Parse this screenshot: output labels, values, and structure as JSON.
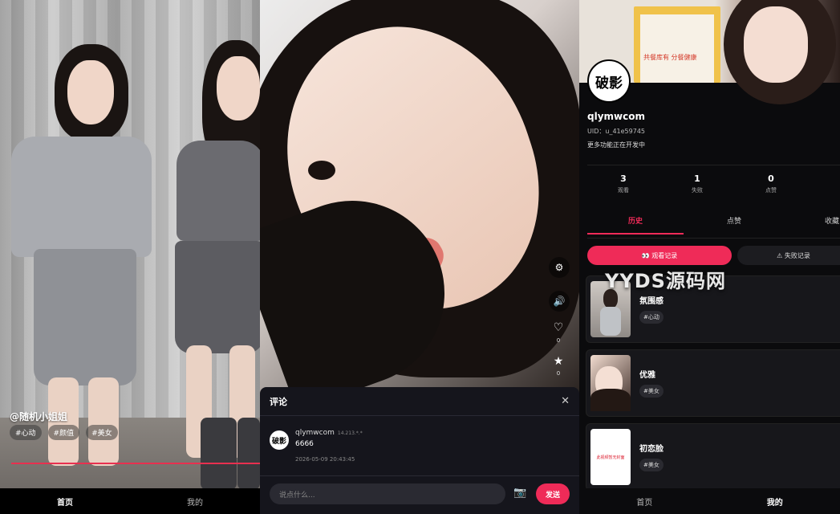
{
  "feed": {
    "username": "@随机小姐姐",
    "tags": [
      "#心动",
      "#颜值",
      "#美女"
    ],
    "playback_progress": 1.0
  },
  "nav_left": {
    "home": "首页",
    "mine": "我的"
  },
  "player": {
    "settings_icon": "gear-icon",
    "sound_icon": "speaker-icon",
    "like_icon": "heart-icon",
    "like_count": "0",
    "fav_icon": "star-icon",
    "fav_count": "0"
  },
  "comments": {
    "title": "评论",
    "close_icon": "close-icon",
    "items": [
      {
        "avatar_text": "破影",
        "user": "qlymwcom",
        "ip": "14.213.*.*",
        "text": "6666",
        "time": "2026-05-09 20:43:45"
      }
    ],
    "input_placeholder": "说点什么...",
    "camera_icon": "camera-icon",
    "send_label": "发送"
  },
  "profile": {
    "banner_text": "共餐库有 分餐健康",
    "avatar_text": "破影",
    "username": "qlymwcom",
    "uid": "UID：u_41e59745",
    "note": "更多功能正在开发中",
    "stats": [
      {
        "value": "3",
        "label": "观看"
      },
      {
        "value": "1",
        "label": "失败"
      },
      {
        "value": "0",
        "label": "点赞"
      }
    ],
    "tabs": [
      "历史",
      "点赞",
      "收藏"
    ],
    "active_tab": 0,
    "pills": {
      "history": "👀 观看记录",
      "failed": "⚠ 失败记录"
    },
    "watermark": "YYDS源码网",
    "videos": [
      {
        "title": "氛围感",
        "tag": "#心动",
        "thumb_text": ""
      },
      {
        "title": "优雅",
        "tag": "#美女",
        "thumb_text": ""
      },
      {
        "title": "初恋脸",
        "tag": "#美女",
        "thumb_text": "此视频暂无封面"
      }
    ]
  },
  "nav_right": {
    "home": "首页",
    "mine": "我的"
  },
  "colors": {
    "accent": "#ef2b58",
    "sheet": "#15151c",
    "card": "#17171b"
  }
}
